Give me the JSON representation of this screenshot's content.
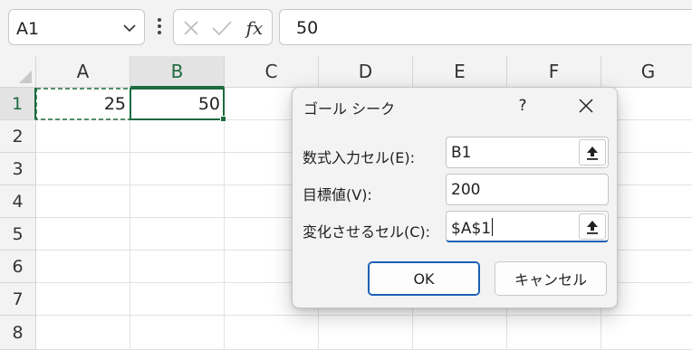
{
  "formula_bar": {
    "name_box": "A1",
    "cancel_glyph": "✕",
    "enter_glyph": "✓",
    "function_label": "fx",
    "formula_value": "50"
  },
  "grid": {
    "columns": [
      "A",
      "B",
      "C",
      "D",
      "E",
      "F",
      "G"
    ],
    "rows": [
      "1",
      "2",
      "3",
      "4",
      "5",
      "6",
      "7",
      "8"
    ],
    "cells": {
      "A1": "25",
      "B1": "50"
    },
    "selected_cell": "B1",
    "accent_color": "#1d6b3e"
  },
  "dialog": {
    "title": "ゴール シーク",
    "help": "?",
    "set_cell": {
      "label": "数式入力セル(E):",
      "value": "B1"
    },
    "to_value": {
      "label": "目標値(V):",
      "value": "200"
    },
    "by_changing": {
      "label": "変化させるセル(C):",
      "value": "$A$1"
    },
    "ok_label": "OK",
    "cancel_label": "キャンセル",
    "accent_color": "#1a5fb4"
  },
  "icons": [
    "chevron-down-icon",
    "more-vertical-icon",
    "close-icon",
    "check-icon",
    "collapse-dialog-icon"
  ]
}
